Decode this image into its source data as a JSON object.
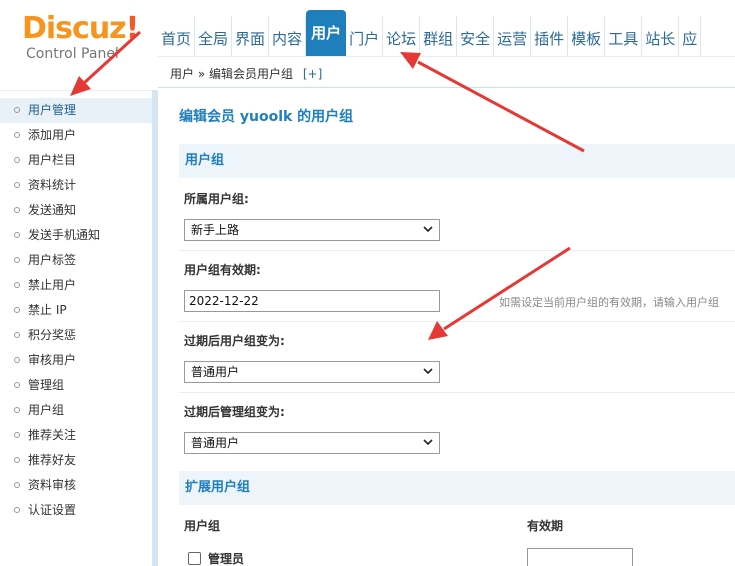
{
  "logo": {
    "brand": "Discuz",
    "bang": "!",
    "subtitle": "Control Panel"
  },
  "topnav": {
    "items": [
      {
        "label": "首页",
        "active": false
      },
      {
        "label": "全局",
        "active": false
      },
      {
        "label": "界面",
        "active": false
      },
      {
        "label": "内容",
        "active": false
      },
      {
        "label": "用户",
        "active": true
      },
      {
        "label": "门户",
        "active": false
      },
      {
        "label": "论坛",
        "active": false
      },
      {
        "label": "群组",
        "active": false
      },
      {
        "label": "安全",
        "active": false
      },
      {
        "label": "运营",
        "active": false
      },
      {
        "label": "插件",
        "active": false
      },
      {
        "label": "模板",
        "active": false
      },
      {
        "label": "工具",
        "active": false
      },
      {
        "label": "站长",
        "active": false
      },
      {
        "label": "应",
        "active": false
      }
    ]
  },
  "breadcrumb": {
    "root": "用户",
    "sep": "»",
    "current": "编辑会员用户组",
    "plus": "[+]"
  },
  "sidebar": {
    "items": [
      {
        "label": "用户管理",
        "active": true
      },
      {
        "label": "添加用户",
        "active": false
      },
      {
        "label": "用户栏目",
        "active": false
      },
      {
        "label": "资料统计",
        "active": false
      },
      {
        "label": "发送通知",
        "active": false
      },
      {
        "label": "发送手机通知",
        "active": false
      },
      {
        "label": "用户标签",
        "active": false
      },
      {
        "label": "禁止用户",
        "active": false
      },
      {
        "label": "禁止 IP",
        "active": false
      },
      {
        "label": "积分奖惩",
        "active": false
      },
      {
        "label": "审核用户",
        "active": false
      },
      {
        "label": "管理组",
        "active": false
      },
      {
        "label": "用户组",
        "active": false
      },
      {
        "label": "推荐关注",
        "active": false
      },
      {
        "label": "推荐好友",
        "active": false
      },
      {
        "label": "资料审核",
        "active": false
      },
      {
        "label": "认证设置",
        "active": false
      }
    ]
  },
  "main": {
    "title": "编辑会员 yuoolk 的用户组",
    "section_usergroup": "用户组",
    "group_label": "所属用户组:",
    "group_value": "新手上路",
    "expiry_label": "用户组有效期:",
    "expiry_value": "2022-12-22",
    "expiry_hint": "如需设定当前用户组的有效期，请输入用户组",
    "after_group_label": "过期后用户组变为:",
    "after_group_value": "普通用户",
    "after_admin_label": "过期后管理组变为:",
    "after_admin_value": "普通用户",
    "section_extended": "扩展用户组",
    "ext_col_group": "用户组",
    "ext_col_valid": "有效期",
    "ext_row1_label": "管理员"
  },
  "colors": {
    "accent": "#1f7fbd",
    "arrow": "#e53935",
    "section_bg": "#edf4fa"
  }
}
